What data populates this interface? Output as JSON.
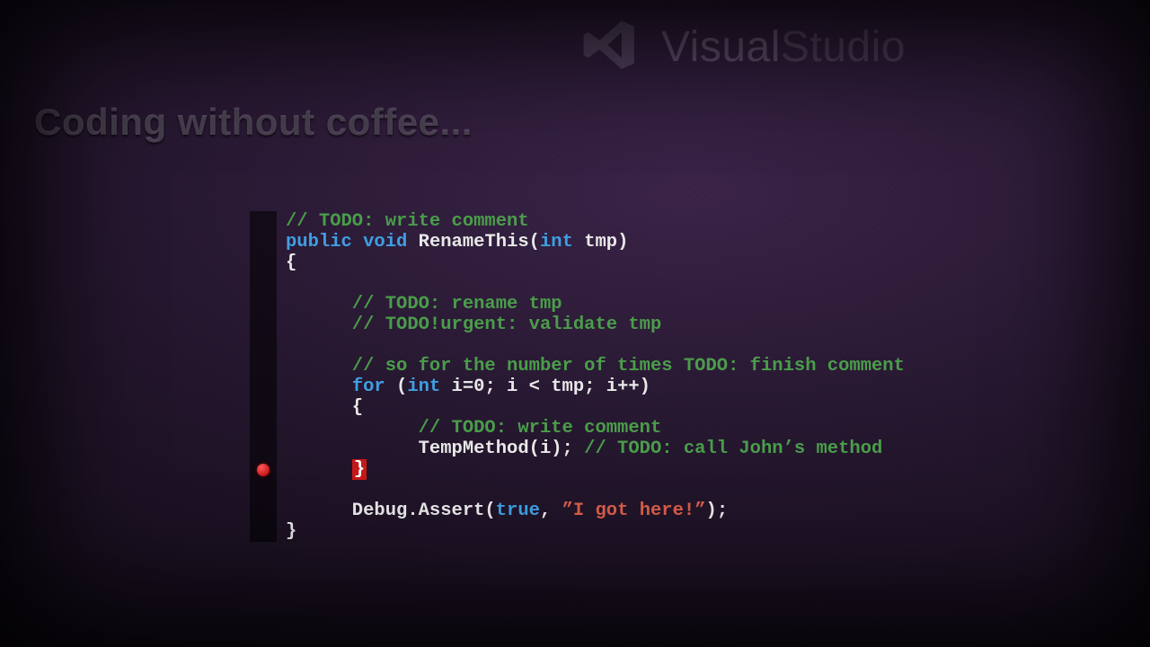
{
  "brand": {
    "name_bold": "Visual",
    "name_light": "Studio"
  },
  "tagline": "Coding without coffee...",
  "breakpoint_line_index": 12,
  "code": {
    "l0": "// TODO: write comment",
    "l1a": "public",
    "l1b": "void",
    "l1c": "RenameThis(",
    "l1d": "int",
    "l1e": " tmp)",
    "l2": "{",
    "l3": "",
    "l4": "      // TODO: rename tmp",
    "l5": "      // TODO!urgent: validate tmp",
    "l6": "",
    "l7": "      // so for the number of times TODO: finish comment",
    "l8a": "for",
    "l8b": " (",
    "l8c": "int",
    "l8d": " i=0; i < tmp; i++)",
    "l9": "      {",
    "l10": "            // TODO: write comment",
    "l11a": "            TempMethod(i); ",
    "l11b": "// TODO: call John’s method",
    "l12pad": "      ",
    "l12brace": "}",
    "l13": "",
    "l14a": "      Debug.Assert(",
    "l14b": "true",
    "l14c": ", ",
    "l14d": "”I got here!”",
    "l14e": ");",
    "l15": "}"
  }
}
